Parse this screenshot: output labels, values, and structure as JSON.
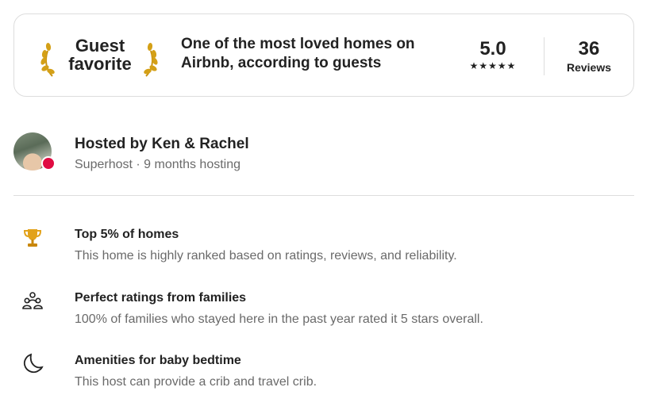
{
  "guest_favorite": {
    "title_line1": "Guest",
    "title_line2": "favorite",
    "description": "One of the most loved homes on Airbnb, according to guests",
    "rating": "5.0",
    "stars": "★★★★★",
    "reviews_count": "36",
    "reviews_label": "Reviews",
    "laurel_icon": "laurel-icon",
    "laurel_color": "#d4a017"
  },
  "host": {
    "title": "Hosted by Ken & Rachel",
    "subtitle": "Superhost · 9 months hosting",
    "badge_color": "#e00b41"
  },
  "highlights": [
    {
      "icon": "trophy-icon",
      "title": "Top 5% of homes",
      "description": "This home is highly ranked based on ratings, reviews, and reliability."
    },
    {
      "icon": "family-icon",
      "title": "Perfect ratings from families",
      "description": "100% of families who stayed here in the past year rated it 5 stars overall."
    },
    {
      "icon": "moon-icon",
      "title": "Amenities for baby bedtime",
      "description": "This host can provide a crib and travel crib."
    }
  ]
}
